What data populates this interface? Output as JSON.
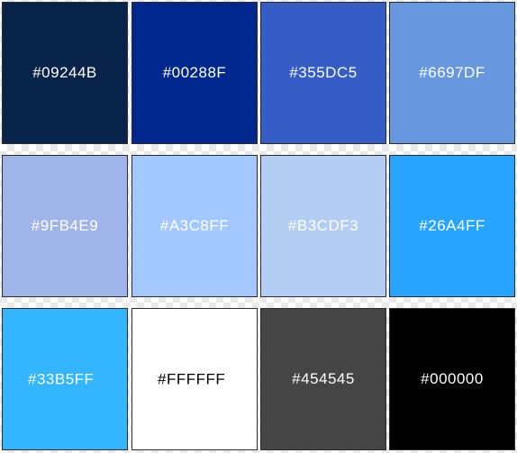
{
  "swatches": [
    {
      "label": "#09244B",
      "color": "#09244B"
    },
    {
      "label": "#00288F",
      "color": "#00288F"
    },
    {
      "label": "#355DC5",
      "color": "#355DC5"
    },
    {
      "label": "#6697DF",
      "color": "#6697DF"
    },
    {
      "label": "#9FB4E9",
      "color": "#9FB4E9"
    },
    {
      "label": "#A3C8FF",
      "color": "#A3C8FF"
    },
    {
      "label": "#B3CDF3",
      "color": "#B3CDF3"
    },
    {
      "label": "#26A4FF",
      "color": "#26A4FF"
    },
    {
      "label": "#33B5FF",
      "color": "#33B5FF"
    },
    {
      "label": "#FFFFFF",
      "color": "#FFFFFF"
    },
    {
      "label": "#454545",
      "color": "#454545"
    },
    {
      "label": "#000000",
      "color": "#000000"
    }
  ]
}
